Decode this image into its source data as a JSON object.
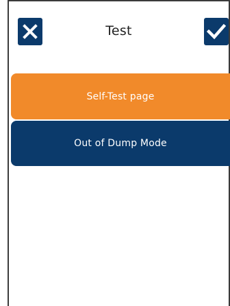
{
  "header": {
    "title": "Test",
    "close_icon": "close-icon",
    "confirm_icon": "checkmark-icon"
  },
  "options": [
    {
      "label": "Self-Test page",
      "color": "#f18a2a"
    },
    {
      "label": "Out of Dump Mode",
      "color": "#0b3a6b"
    }
  ],
  "colors": {
    "icon_bg": "#0b3a6b",
    "icon_fg": "#ffffff",
    "title_text": "#222222",
    "frame": "#3a3a3a"
  }
}
